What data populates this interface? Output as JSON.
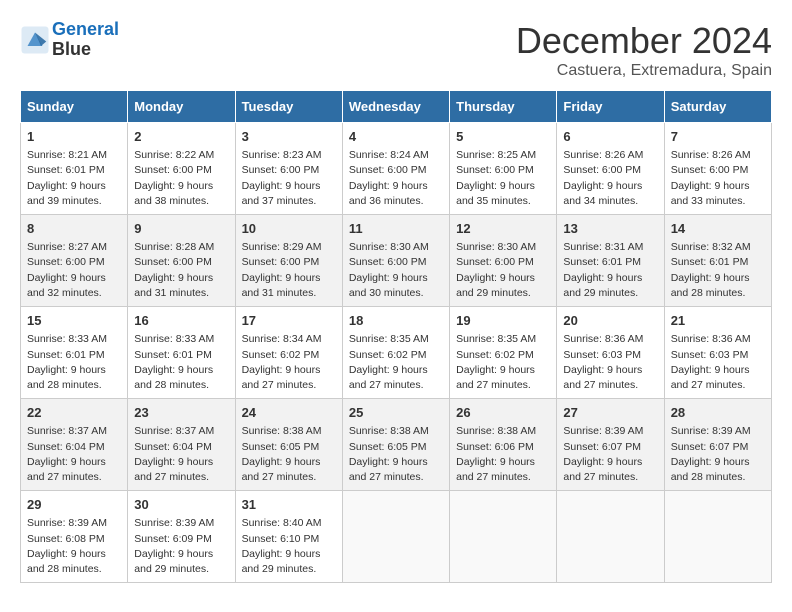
{
  "header": {
    "logo_line1": "General",
    "logo_line2": "Blue",
    "month": "December 2024",
    "location": "Castuera, Extremadura, Spain"
  },
  "weekdays": [
    "Sunday",
    "Monday",
    "Tuesday",
    "Wednesday",
    "Thursday",
    "Friday",
    "Saturday"
  ],
  "weeks": [
    [
      {
        "day": "1",
        "sunrise": "8:21 AM",
        "sunset": "6:01 PM",
        "daylight": "9 hours and 39 minutes."
      },
      {
        "day": "2",
        "sunrise": "8:22 AM",
        "sunset": "6:00 PM",
        "daylight": "9 hours and 38 minutes."
      },
      {
        "day": "3",
        "sunrise": "8:23 AM",
        "sunset": "6:00 PM",
        "daylight": "9 hours and 37 minutes."
      },
      {
        "day": "4",
        "sunrise": "8:24 AM",
        "sunset": "6:00 PM",
        "daylight": "9 hours and 36 minutes."
      },
      {
        "day": "5",
        "sunrise": "8:25 AM",
        "sunset": "6:00 PM",
        "daylight": "9 hours and 35 minutes."
      },
      {
        "day": "6",
        "sunrise": "8:26 AM",
        "sunset": "6:00 PM",
        "daylight": "9 hours and 34 minutes."
      },
      {
        "day": "7",
        "sunrise": "8:26 AM",
        "sunset": "6:00 PM",
        "daylight": "9 hours and 33 minutes."
      }
    ],
    [
      {
        "day": "8",
        "sunrise": "8:27 AM",
        "sunset": "6:00 PM",
        "daylight": "9 hours and 32 minutes."
      },
      {
        "day": "9",
        "sunrise": "8:28 AM",
        "sunset": "6:00 PM",
        "daylight": "9 hours and 31 minutes."
      },
      {
        "day": "10",
        "sunrise": "8:29 AM",
        "sunset": "6:00 PM",
        "daylight": "9 hours and 31 minutes."
      },
      {
        "day": "11",
        "sunrise": "8:30 AM",
        "sunset": "6:00 PM",
        "daylight": "9 hours and 30 minutes."
      },
      {
        "day": "12",
        "sunrise": "8:30 AM",
        "sunset": "6:00 PM",
        "daylight": "9 hours and 29 minutes."
      },
      {
        "day": "13",
        "sunrise": "8:31 AM",
        "sunset": "6:01 PM",
        "daylight": "9 hours and 29 minutes."
      },
      {
        "day": "14",
        "sunrise": "8:32 AM",
        "sunset": "6:01 PM",
        "daylight": "9 hours and 28 minutes."
      }
    ],
    [
      {
        "day": "15",
        "sunrise": "8:33 AM",
        "sunset": "6:01 PM",
        "daylight": "9 hours and 28 minutes."
      },
      {
        "day": "16",
        "sunrise": "8:33 AM",
        "sunset": "6:01 PM",
        "daylight": "9 hours and 28 minutes."
      },
      {
        "day": "17",
        "sunrise": "8:34 AM",
        "sunset": "6:02 PM",
        "daylight": "9 hours and 27 minutes."
      },
      {
        "day": "18",
        "sunrise": "8:35 AM",
        "sunset": "6:02 PM",
        "daylight": "9 hours and 27 minutes."
      },
      {
        "day": "19",
        "sunrise": "8:35 AM",
        "sunset": "6:02 PM",
        "daylight": "9 hours and 27 minutes."
      },
      {
        "day": "20",
        "sunrise": "8:36 AM",
        "sunset": "6:03 PM",
        "daylight": "9 hours and 27 minutes."
      },
      {
        "day": "21",
        "sunrise": "8:36 AM",
        "sunset": "6:03 PM",
        "daylight": "9 hours and 27 minutes."
      }
    ],
    [
      {
        "day": "22",
        "sunrise": "8:37 AM",
        "sunset": "6:04 PM",
        "daylight": "9 hours and 27 minutes."
      },
      {
        "day": "23",
        "sunrise": "8:37 AM",
        "sunset": "6:04 PM",
        "daylight": "9 hours and 27 minutes."
      },
      {
        "day": "24",
        "sunrise": "8:38 AM",
        "sunset": "6:05 PM",
        "daylight": "9 hours and 27 minutes."
      },
      {
        "day": "25",
        "sunrise": "8:38 AM",
        "sunset": "6:05 PM",
        "daylight": "9 hours and 27 minutes."
      },
      {
        "day": "26",
        "sunrise": "8:38 AM",
        "sunset": "6:06 PM",
        "daylight": "9 hours and 27 minutes."
      },
      {
        "day": "27",
        "sunrise": "8:39 AM",
        "sunset": "6:07 PM",
        "daylight": "9 hours and 27 minutes."
      },
      {
        "day": "28",
        "sunrise": "8:39 AM",
        "sunset": "6:07 PM",
        "daylight": "9 hours and 28 minutes."
      }
    ],
    [
      {
        "day": "29",
        "sunrise": "8:39 AM",
        "sunset": "6:08 PM",
        "daylight": "9 hours and 28 minutes."
      },
      {
        "day": "30",
        "sunrise": "8:39 AM",
        "sunset": "6:09 PM",
        "daylight": "9 hours and 29 minutes."
      },
      {
        "day": "31",
        "sunrise": "8:40 AM",
        "sunset": "6:10 PM",
        "daylight": "9 hours and 29 minutes."
      },
      null,
      null,
      null,
      null
    ]
  ]
}
